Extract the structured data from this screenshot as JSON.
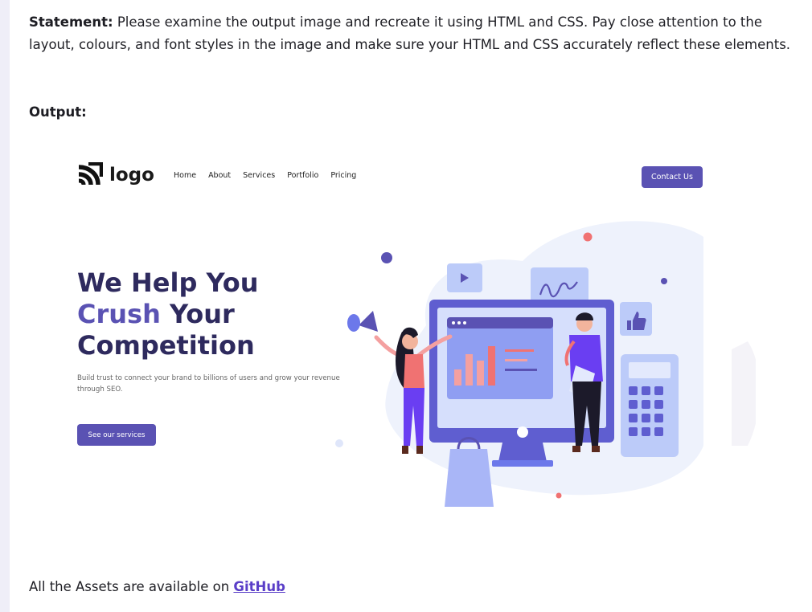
{
  "statement": {
    "label": "Statement:",
    "text": "Please examine the output image and recreate it using HTML and CSS. Pay close attention to the layout, colours, and font styles in the image and make sure your HTML and CSS accurately reflect these elements."
  },
  "output_label": "Output:",
  "preview": {
    "logo_text": "logo",
    "nav": [
      "Home",
      "About",
      "Services",
      "Portfolio",
      "Pricing"
    ],
    "contact_label": "Contact Us",
    "hero": {
      "line1": "We Help You",
      "line2_accent": "Crush",
      "line2_rest": " Your",
      "line3": "Competition",
      "subtitle": "Build trust to connect your brand to billions of users and grow your revenue through SEO.",
      "cta_label": "See our services"
    },
    "colors": {
      "primary": "#5a52b3",
      "heading": "#2e2a5e",
      "accent_red": "#f07272",
      "blob": "#eef2fc"
    }
  },
  "footer": {
    "prefix": "All the Assets are available on ",
    "link_label": "GitHub"
  }
}
